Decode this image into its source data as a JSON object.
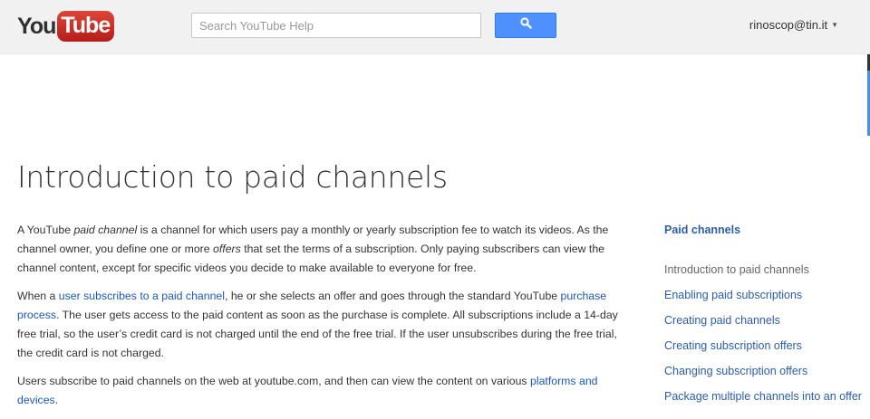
{
  "header": {
    "logo": {
      "you": "You",
      "tube": "Tube"
    },
    "search": {
      "placeholder": "Search YouTube Help",
      "value": ""
    },
    "search_button_icon": "search-icon",
    "account": {
      "email": "rinoscop@tin.it",
      "caret_icon": "chevron-down-icon"
    }
  },
  "main": {
    "title": "Introduction to paid channels",
    "p1": {
      "t1": "A YouTube ",
      "em1": "paid channel",
      "t2": " is a channel for which users pay a monthly or yearly subscription fee to watch its videos. As the channel owner, you define one or more ",
      "em2": "offers",
      "t3": " that set the terms of a subscription. Only paying subscribers can view the channel content, except for specific videos you decide to make available to everyone for free."
    },
    "p2": {
      "t1": "When a ",
      "link1": "user subscribes to a paid channel",
      "t2": ", he or she selects an offer and goes through the standard YouTube ",
      "link2": "purchase process",
      "t3": ". The user gets access to the paid content as soon as the purchase is complete. All subscriptions include a 14-day free trial, so the user’s credit card is not charged until the end of the free trial. If the user unsubscribes during the free trial, the credit card is not charged."
    },
    "p3": {
      "t1": "Users subscribe to paid channels on the web at youtube.com, and then can view the content on various ",
      "link1": "platforms and devices",
      "t2": "."
    }
  },
  "sidebar": {
    "heading": "Paid channels",
    "items": [
      {
        "label": "Introduction to paid channels",
        "current": true
      },
      {
        "label": "Enabling paid subscriptions",
        "current": false
      },
      {
        "label": "Creating paid channels",
        "current": false
      },
      {
        "label": "Creating subscription offers",
        "current": false
      },
      {
        "label": "Changing subscription offers",
        "current": false
      },
      {
        "label": "Package multiple channels into an offer",
        "current": false
      }
    ]
  },
  "colors": {
    "link": "#1a56c2",
    "search_button": "#4d90fe",
    "logo_red": "#c4302b"
  }
}
